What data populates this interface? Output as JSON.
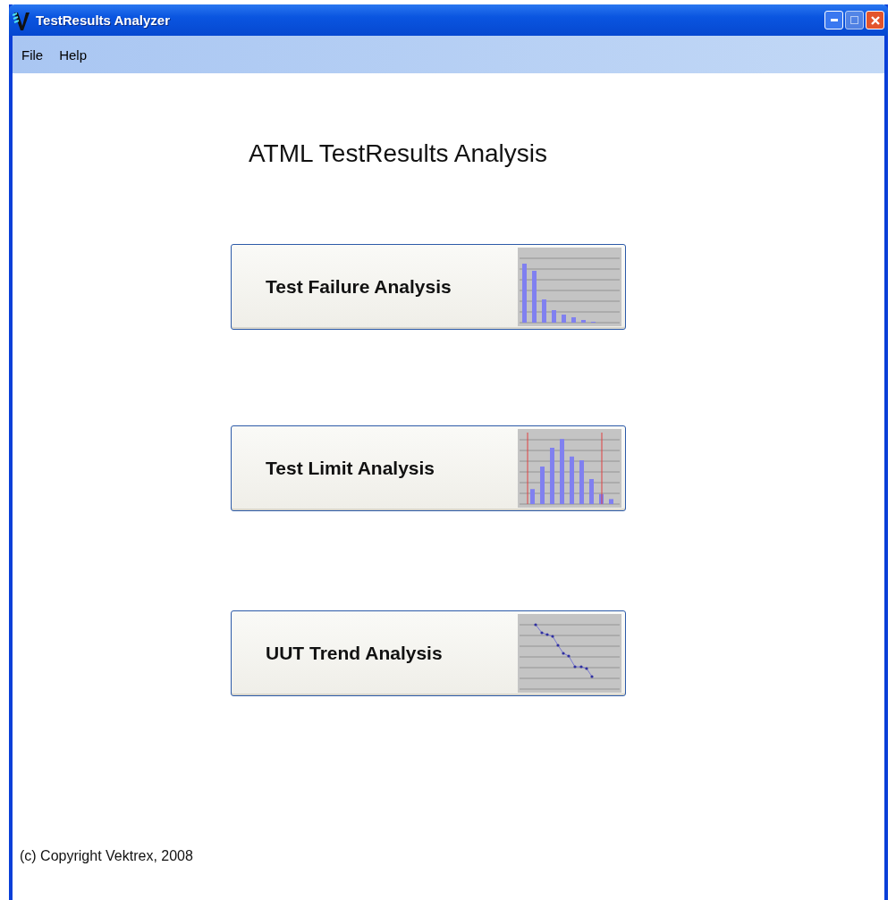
{
  "window": {
    "title": "TestResults Analyzer"
  },
  "menu": [
    "File",
    "Help"
  ],
  "heading": "ATML TestResults Analysis",
  "buttons": [
    {
      "label": "Test Failure Analysis",
      "kind": "pareto"
    },
    {
      "label": "Test Limit Analysis",
      "kind": "histogram"
    },
    {
      "label": "UUT Trend Analysis",
      "kind": "trend"
    }
  ],
  "copyright": "(c) Copyright Vektrex, 2008"
}
